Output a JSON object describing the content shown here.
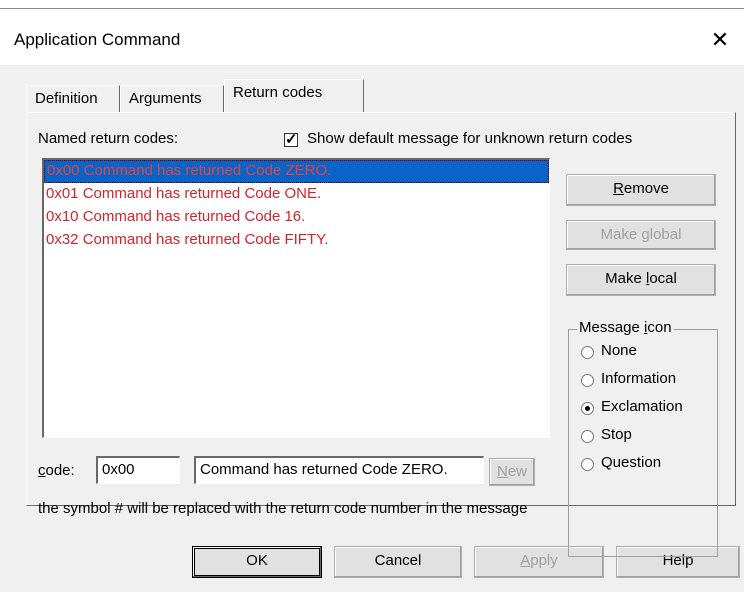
{
  "window": {
    "title": "Application Command"
  },
  "tabs": [
    {
      "label": "Definition"
    },
    {
      "label": "Arguments"
    },
    {
      "label": "Return codes",
      "active": true
    }
  ],
  "named_label": "Named return codes:",
  "show_default": {
    "label": "Show default message for unknown return codes",
    "checked": true
  },
  "return_codes": [
    {
      "text": "0x00 Command has returned Code ZERO.",
      "selected": true
    },
    {
      "text": "0x01 Command has returned Code ONE."
    },
    {
      "text": "0x10 Command has returned Code 16."
    },
    {
      "text": "0x32 Command has returned Code FIFTY."
    }
  ],
  "buttons": {
    "remove": "Remove",
    "make_global": "Make global",
    "make_local": "Make local",
    "new": "New",
    "ok": "OK",
    "cancel": "Cancel",
    "apply": "Apply",
    "help": "Help"
  },
  "message_icon": {
    "label": "Message icon",
    "options": [
      "None",
      "Information",
      "Exclamation",
      "Stop",
      "Question"
    ],
    "selected": "Exclamation"
  },
  "code": {
    "label": "code:",
    "value": "0x00",
    "message": "Command has returned Code ZERO."
  },
  "hint": "the symbol # will be replaced with the return code number in the message",
  "colors": {
    "list_text": "#d1252e",
    "selection": "#0a64c8"
  }
}
